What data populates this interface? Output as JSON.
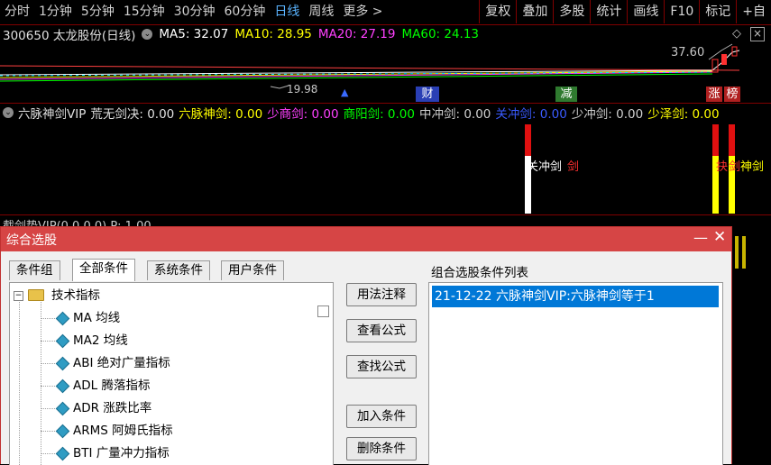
{
  "toolbar": {
    "periods": [
      "分时",
      "1分钟",
      "5分钟",
      "15分钟",
      "30分钟",
      "60分钟",
      "日线",
      "周线",
      "更多 >"
    ],
    "active_period": "日线",
    "tools": [
      "复权",
      "叠加",
      "多股",
      "统计",
      "画线",
      "F10",
      "标记",
      "+自"
    ]
  },
  "stock": {
    "code_name": "300650 太龙股份(日线)",
    "ma5": "MA5: 32.07",
    "ma10": "MA10: 28.95",
    "ma20": "MA20: 27.19",
    "ma60": "MA60: 24.13",
    "high_label": "37.60",
    "low_label": "19.98",
    "event_labels": [
      "财",
      "减",
      "涨",
      "榜"
    ],
    "colors": {
      "ma5": "#ffffff",
      "ma10": "#ffff00",
      "ma20": "#ff40ff",
      "ma60": "#00ff00"
    }
  },
  "indicator": {
    "name": "六脉神剑VIP",
    "fields": [
      {
        "text": "荒无剑决: 0.00",
        "color": "#e0e0e0"
      },
      {
        "text": "六脉神剑: 0.00",
        "color": "#ffff00"
      },
      {
        "text": "少商剑: 0.00",
        "color": "#ff40ff"
      },
      {
        "text": "商阳剑: 0.00",
        "color": "#00ff00"
      },
      {
        "text": "中冲剑: 0.00",
        "color": "#d0d0d0"
      },
      {
        "text": "关冲剑: 0.00",
        "color": "#3a5bff"
      },
      {
        "text": "少冲剑: 0.00",
        "color": "#d0d0d0"
      },
      {
        "text": "少泽剑: 0.00",
        "color": "#ffff00"
      }
    ],
    "bar_labels": [
      "关冲剑",
      "剑",
      "抉",
      "剑",
      "神剑"
    ]
  },
  "indicator2": {
    "header": "截剑势VIP(0,0,0,0)  P: 1.00"
  },
  "dialog": {
    "title": "综合选股",
    "tabs": [
      "条件组",
      "全部条件",
      "系统条件",
      "用户条件"
    ],
    "active_tab": "全部条件",
    "tree": {
      "root": "技术指标",
      "items": [
        "MA 均线",
        "MA2 均线",
        "ABI 绝对广量指标",
        "ADL 腾落指标",
        "ADR 涨跌比率",
        "ARMS 阿姆氏指标",
        "BTI 广量冲力指标"
      ]
    },
    "buttons": [
      "用法注释",
      "查看公式",
      "查找公式",
      "加入条件",
      "删除条件"
    ],
    "list_label": "组合选股条件列表",
    "list_items": [
      "21-12-22 六脉神剑VIP:六脉神剑等于1"
    ]
  }
}
